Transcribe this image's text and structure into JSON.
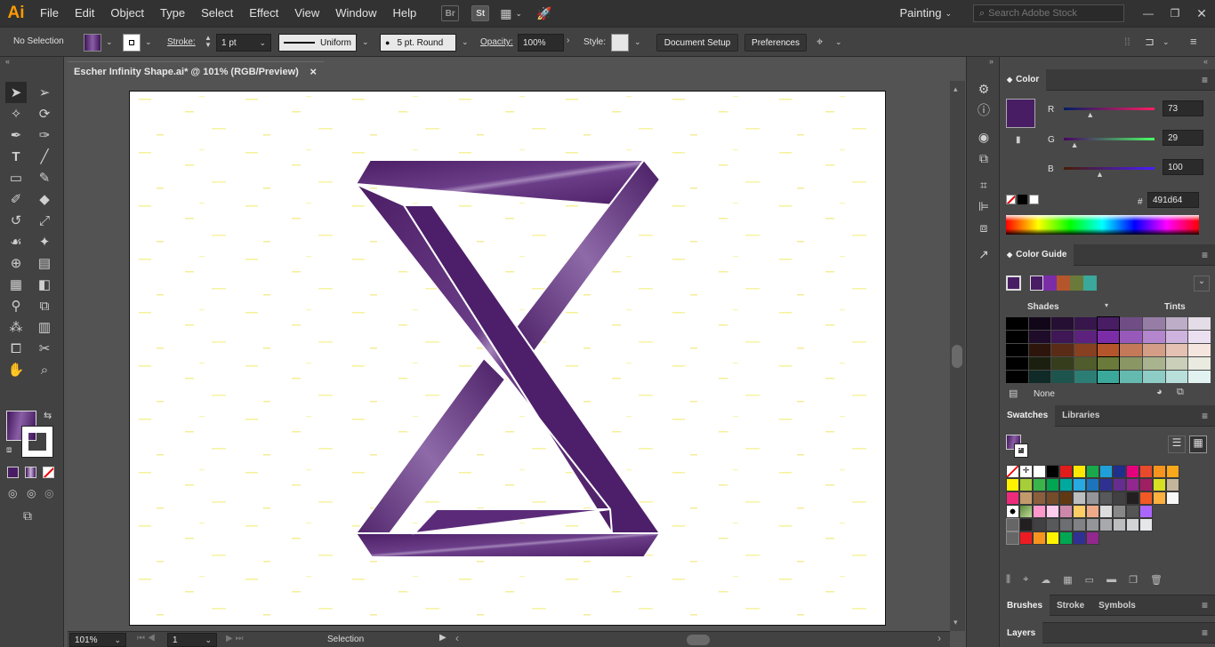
{
  "app": {
    "logo": "Ai",
    "workspace": "Painting",
    "search_placeholder": "Search Adobe Stock"
  },
  "menus": [
    "File",
    "Edit",
    "Object",
    "Type",
    "Select",
    "Effect",
    "View",
    "Window",
    "Help"
  ],
  "menu_badges": {
    "bridge": "Br",
    "stock": "St"
  },
  "control": {
    "selection": "No Selection",
    "stroke_label": "Stroke:",
    "stroke_weight": "1 pt",
    "profile": "Uniform",
    "brush": "5 pt. Round",
    "opacity_label": "Opacity:",
    "opacity": "100%",
    "style_label": "Style:",
    "document_setup": "Document Setup",
    "preferences": "Preferences"
  },
  "document": {
    "tab_title": "Escher Infinity Shape.ai* @ 101% (RGB/Preview)",
    "close": "×"
  },
  "status": {
    "zoom": "101%",
    "artboard": "1",
    "tool": "Selection"
  },
  "panels": {
    "color": {
      "title": "Color",
      "r_label": "R",
      "g_label": "G",
      "b_label": "B",
      "r": "73",
      "g": "29",
      "b": "100",
      "r_value": 73,
      "g_value": 29,
      "b_value": 100,
      "hash": "#",
      "hex": "491d64",
      "fill": "#491d64"
    },
    "color_guide": {
      "title": "Color Guide",
      "shades": "Shades",
      "tints": "Tints",
      "none": "None"
    },
    "swatches": {
      "tab": "Swatches",
      "libraries": "Libraries"
    },
    "bottom_tabs": [
      "Brushes",
      "Stroke",
      "Symbols"
    ],
    "layers": "Layers"
  },
  "colors": {
    "accent": "#491d64",
    "purple_light": "#7a4f94",
    "harmony": [
      "#7b2da8",
      "#9a3fb0",
      "#b4552b",
      "#6a7a3a",
      "#3aa89a"
    ]
  }
}
